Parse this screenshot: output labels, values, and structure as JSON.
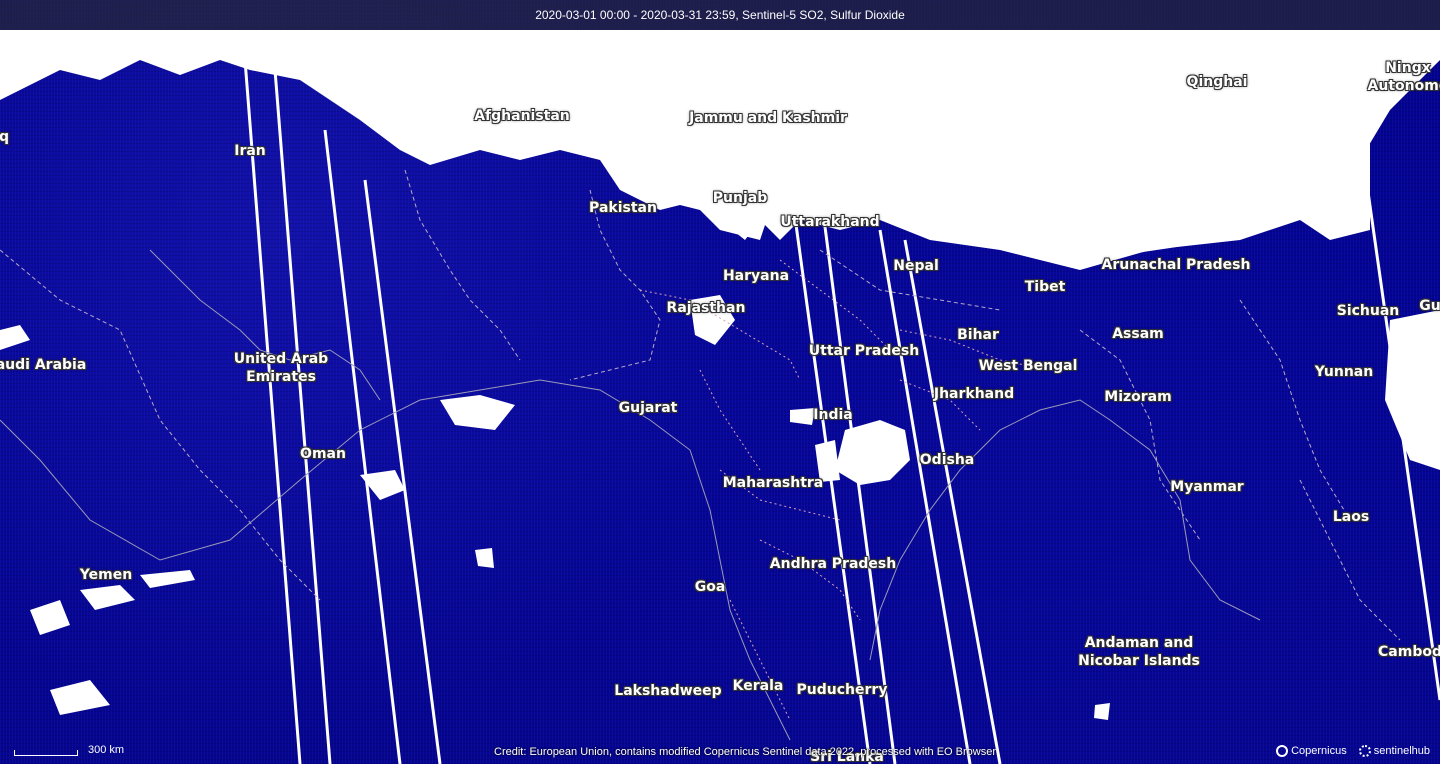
{
  "header": {
    "title": "2020-03-01 00:00 - 2020-03-31 23:59, Sentinel-5 SO2, Sulfur Dioxide"
  },
  "colors": {
    "background": "#03038f",
    "clouds": "#ffffff",
    "borders_country": "#b7a9c9",
    "borders_state": "#d8a0b8"
  },
  "places": [
    {
      "id": "qinghai",
      "label": "Qinghai"
    },
    {
      "id": "ningxia",
      "label": "Ningx\nAutonomo"
    },
    {
      "id": "afghanistan",
      "label": "Afghanistan"
    },
    {
      "id": "jammu",
      "label": "Jammu and Kashmir"
    },
    {
      "id": "iraq",
      "label": "q"
    },
    {
      "id": "iran",
      "label": "Iran"
    },
    {
      "id": "punjab",
      "label": "Punjab"
    },
    {
      "id": "pakistan",
      "label": "Pakistan"
    },
    {
      "id": "uttarakhand",
      "label": "Uttarakhand"
    },
    {
      "id": "nepal",
      "label": "Nepal"
    },
    {
      "id": "arunachal",
      "label": "Arunachal Pradesh"
    },
    {
      "id": "haryana",
      "label": "Haryana"
    },
    {
      "id": "tibet",
      "label": "Tibet"
    },
    {
      "id": "rajasthan",
      "label": "Rajasthan"
    },
    {
      "id": "sichuan",
      "label": "Sichuan"
    },
    {
      "id": "gu",
      "label": "Gu"
    },
    {
      "id": "bihar",
      "label": "Bihar"
    },
    {
      "id": "assam",
      "label": "Assam"
    },
    {
      "id": "uttar",
      "label": "Uttar Pradesh"
    },
    {
      "id": "saudi",
      "label": "audi Arabia"
    },
    {
      "id": "uae",
      "label": "United Arab\nEmirates"
    },
    {
      "id": "westbengal",
      "label": "West Bengal"
    },
    {
      "id": "yunnan",
      "label": "Yunnan"
    },
    {
      "id": "jharkhand",
      "label": "Jharkhand"
    },
    {
      "id": "mizoram",
      "label": "Mizoram"
    },
    {
      "id": "gujarat",
      "label": "Gujarat"
    },
    {
      "id": "india",
      "label": "India"
    },
    {
      "id": "oman",
      "label": "Oman"
    },
    {
      "id": "odisha",
      "label": "Odisha"
    },
    {
      "id": "maharashtra",
      "label": "Maharashtra"
    },
    {
      "id": "myanmar",
      "label": "Myanmar"
    },
    {
      "id": "laos",
      "label": "Laos"
    },
    {
      "id": "andhra",
      "label": "Andhra Pradesh"
    },
    {
      "id": "yemen",
      "label": "Yemen"
    },
    {
      "id": "goa",
      "label": "Goa"
    },
    {
      "id": "andaman",
      "label": "Andaman and\nNicobar Islands"
    },
    {
      "id": "cambodia",
      "label": "Cambod"
    },
    {
      "id": "lakshadweep",
      "label": "Lakshadweep"
    },
    {
      "id": "kerala",
      "label": "Kerala"
    },
    {
      "id": "puducherry",
      "label": "Puducherry"
    },
    {
      "id": "srilanka",
      "label": "Sri Lanka"
    }
  ],
  "scale": {
    "label": "300 km"
  },
  "credit": "Credit: European Union, contains modified Copernicus Sentinel data 2022, processed with EO Browser",
  "logos": {
    "copernicus": "Copernicus",
    "sentinelhub": "sentinelhub"
  }
}
